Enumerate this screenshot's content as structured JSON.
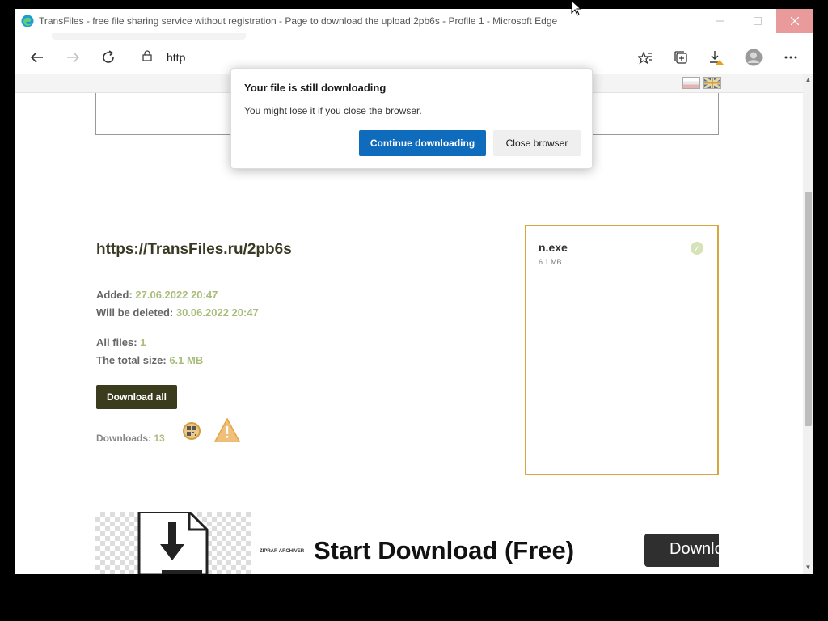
{
  "window": {
    "title": "TransFiles - free file sharing service without registration - Page to download the upload 2pb6s - Profile 1 - Microsoft Edge"
  },
  "toolbar": {
    "address_text": "http",
    "icons": [
      "back-icon",
      "forward-icon",
      "refresh-icon",
      "lock-icon",
      "favorites-icon",
      "collections-icon",
      "downloads-icon",
      "profile-icon",
      "more-icon"
    ]
  },
  "page": {
    "link": "https://TransFiles.ru/2pb6s",
    "added_label": "Added:",
    "added_value": "27.06.2022 20:47",
    "deleted_label": "Will be deleted:",
    "deleted_value": "30.06.2022 20:47",
    "files_label": "All files:",
    "files_value": "1",
    "size_label": "The total size:",
    "size_value": "6.1 MB",
    "download_all_label": "Download all",
    "downloads_label": "Downloads:",
    "downloads_value": "13"
  },
  "file": {
    "name": "n.exe",
    "size": "6.1 MB"
  },
  "ad": {
    "brand": "ZIPRAR ARCHIVER",
    "title": "Start Download (Free)",
    "button_label": "Downlo"
  },
  "dialog": {
    "title": "Your file is still downloading",
    "message": "You might lose it if you close the browser.",
    "primary_label": "Continue downloading",
    "secondary_label": "Close browser"
  },
  "colors": {
    "accent_blue": "#0f6cbd",
    "dark_olive": "#3b3b1e",
    "value_green": "#a9bd7a",
    "panel_border": "#d9a63b"
  }
}
